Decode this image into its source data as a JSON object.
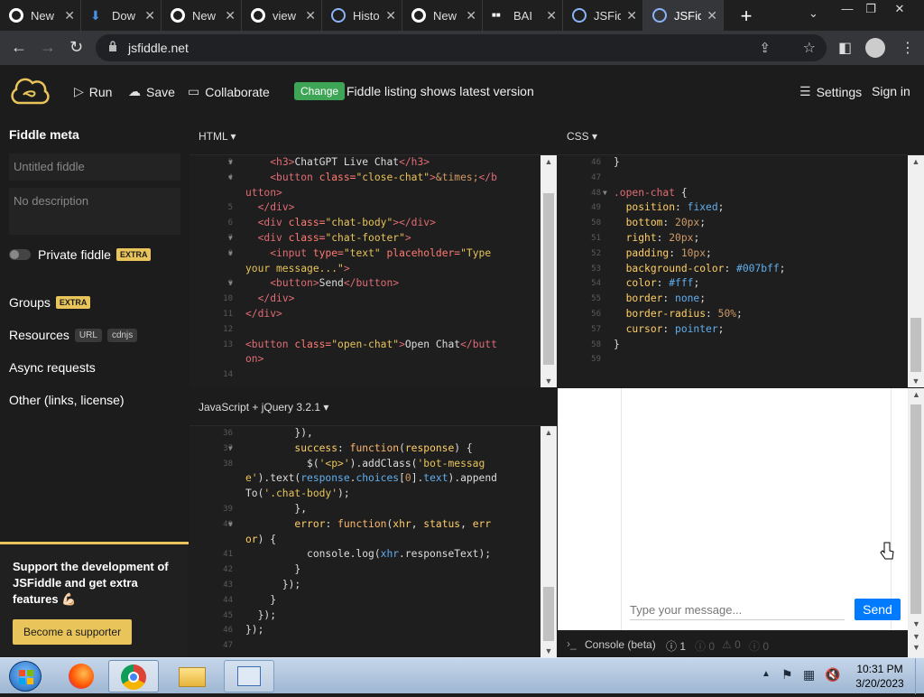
{
  "tabs": [
    {
      "label": "New",
      "icon": "chrome-icon",
      "color": "#ffffff"
    },
    {
      "label": "Dow",
      "icon": "download-icon",
      "color": "#4a90e2"
    },
    {
      "label": "New",
      "icon": "chrome-icon",
      "color": "#ffffff"
    },
    {
      "label": "view",
      "icon": "chrome-icon",
      "color": "#ffffff"
    },
    {
      "label": "Histo",
      "icon": "history-icon",
      "color": "#8ab4f8"
    },
    {
      "label": "New",
      "icon": "chrome-icon",
      "color": "#ffffff"
    },
    {
      "label": "BAI",
      "icon": "bai-icon",
      "color": "#ffffff"
    },
    {
      "label": "JSFid",
      "icon": "jsfiddle-icon",
      "color": "#8ab4f8"
    },
    {
      "label": "JSFid",
      "icon": "jsfiddle-icon",
      "color": "#8ab4f8"
    }
  ],
  "address": {
    "url": "jsfiddle.net"
  },
  "header": {
    "run": "Run",
    "save": "Save",
    "collaborate": "Collaborate",
    "change_badge": "Change",
    "listing_text": "Fiddle listing shows latest version",
    "settings": "Settings",
    "signin": "Sign in"
  },
  "sidebar": {
    "title": "Fiddle meta",
    "title_placeholder": "Untitled fiddle",
    "desc_placeholder": "No description",
    "private_label": "Private fiddle",
    "extra": "EXTRA",
    "groups": "Groups",
    "resources": "Resources",
    "url_badge": "URL",
    "cdnjs_badge": "cdnjs",
    "async": "Async requests",
    "other": "Other (links, license)",
    "support_text": "Support the development of JSFiddle and get extra features 💪🏻",
    "support_button": "Become a supporter"
  },
  "panels": {
    "html_label": "HTML ▾",
    "css_label": "CSS ▾",
    "js_label": "JavaScript + jQuery 3.2.1 ▾"
  },
  "html_lines": [
    "3",
    "4",
    "",
    "5",
    "6",
    "7",
    "8",
    "",
    "9",
    "10",
    "11",
    "12",
    "13",
    "",
    "14"
  ],
  "css_lines": [
    "46",
    "47",
    "48",
    "49",
    "50",
    "51",
    "52",
    "53",
    "54",
    "55",
    "56",
    "57",
    "58",
    "59"
  ],
  "js_lines": [
    "36",
    "37",
    "38",
    "",
    "39",
    "40",
    "",
    "41",
    "42",
    "43",
    "44",
    "45",
    "46",
    "47"
  ],
  "result": {
    "input_placeholder": "Type your message...",
    "send": "Send"
  },
  "console": {
    "label": "Console (beta)",
    "errors": "1",
    "warnings": "0",
    "info": "0",
    "logs": "0"
  },
  "taskbar": {
    "time": "10:31 PM",
    "date": "3/20/2023"
  },
  "colors": {
    "accent_green": "#3fa556",
    "accent_yellow": "#e8c45a",
    "send_blue": "#007bff"
  }
}
